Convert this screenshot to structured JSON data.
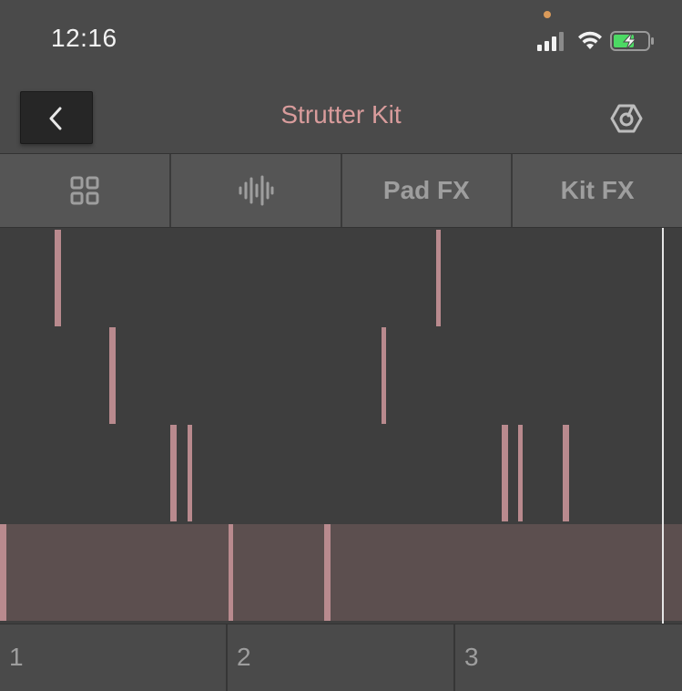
{
  "status_bar": {
    "time": "12:16",
    "privacy_dot_color": "#d99a5a",
    "battery_color": "#4cd964"
  },
  "nav": {
    "title": "Strutter Kit",
    "title_color": "#d99c9c",
    "back_icon": "chevron-left-icon",
    "link_icon": "ableton-link-icon"
  },
  "tabs": [
    {
      "type": "icon",
      "icon": "pads-grid-icon"
    },
    {
      "type": "icon",
      "icon": "waveform-icon"
    },
    {
      "type": "text",
      "label": "Pad FX"
    },
    {
      "type": "text",
      "label": "Kit FX"
    }
  ],
  "sequencer": {
    "note_color": "#b98a8e",
    "lanes": [
      {
        "selected": false,
        "steps": [
          0.08,
          0.64
        ]
      },
      {
        "selected": false,
        "steps": [
          0.16,
          0.56
        ]
      },
      {
        "selected": false,
        "steps": [
          0.25,
          0.275,
          0.735,
          0.76,
          0.825
        ]
      },
      {
        "selected": true,
        "steps": [
          0.0,
          0.335,
          0.475
        ]
      }
    ]
  },
  "ruler": {
    "bars": [
      "1",
      "2",
      "3"
    ]
  }
}
